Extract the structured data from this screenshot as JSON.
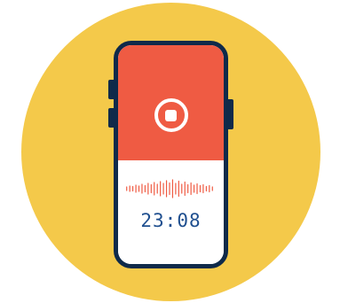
{
  "recorder": {
    "timer": "23:08",
    "state": "recording"
  },
  "colors": {
    "background_circle": "#f4c94a",
    "phone_frame": "#0f2a4a",
    "top_panel": "#ef5b43",
    "screen": "#ffffff",
    "waveform": "#ef5b43",
    "timer_text": "#1f4f8f"
  },
  "icons": {
    "record_control": "stop-icon"
  }
}
